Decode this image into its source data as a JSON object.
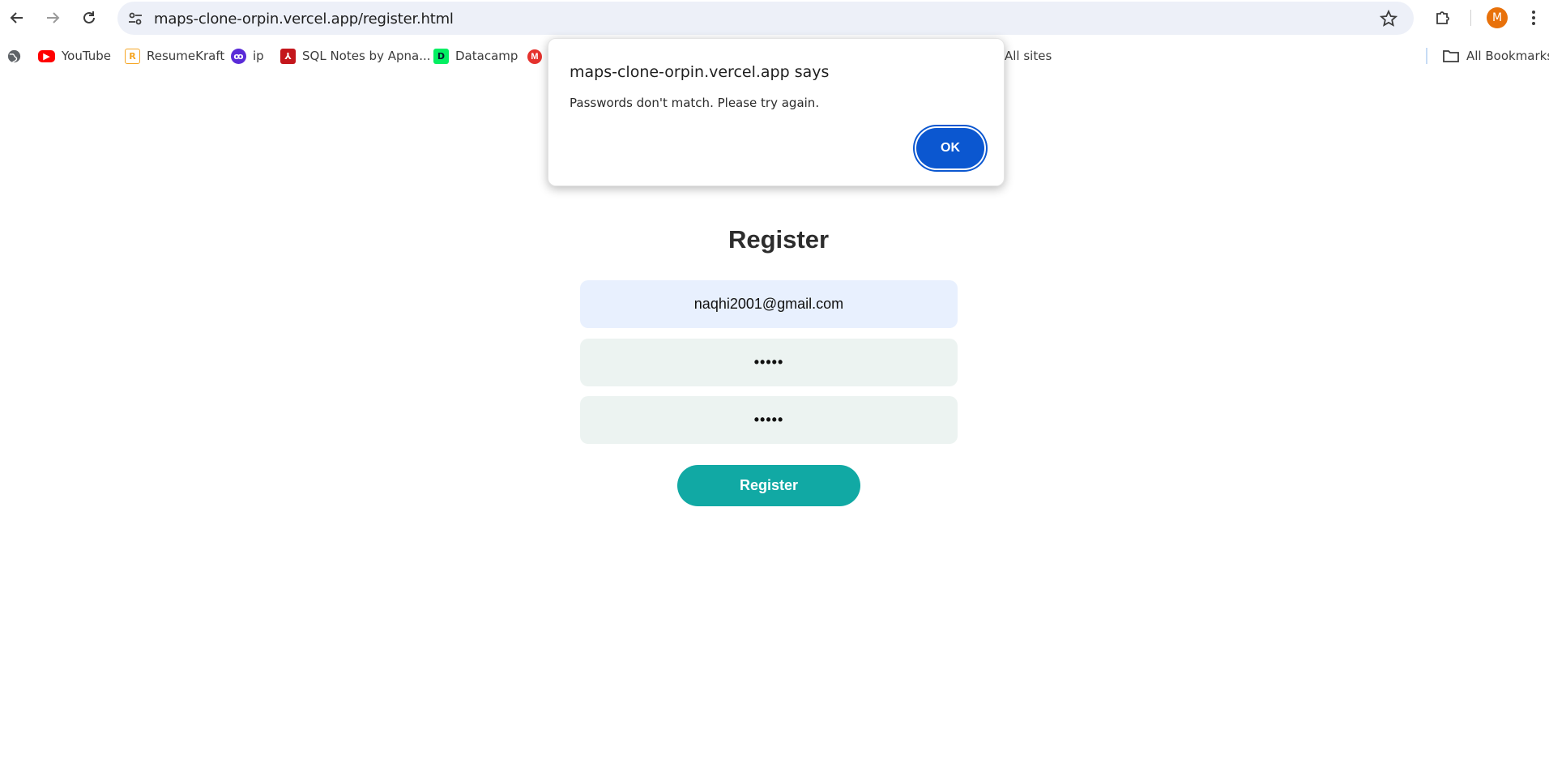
{
  "browser": {
    "url": "maps-clone-orpin.vercel.app/register.html",
    "profile_initial": "M",
    "bookmarks": [
      {
        "label": "YouTube",
        "icon": "youtube-icon"
      },
      {
        "label": "ResumeKraft",
        "icon": "resumekraft-icon"
      },
      {
        "label": "ip",
        "icon": "ip-icon"
      },
      {
        "label": "SQL Notes by Apna...",
        "icon": "pdf-icon"
      },
      {
        "label": "Datacamp",
        "icon": "datacamp-icon"
      }
    ],
    "all_sites_label": "All sites",
    "all_bookmarks_label": "All Bookmarks"
  },
  "alert": {
    "title": "maps-clone-orpin.vercel.app says",
    "message": "Passwords don't match. Please try again.",
    "ok_label": "OK"
  },
  "form": {
    "title": "Register",
    "email_value": "naqhi2001@gmail.com",
    "password_value": "•••••",
    "confirm_value": "•••••",
    "submit_label": "Register"
  },
  "colors": {
    "accent": "#11a9a4",
    "dialog_button": "#0b57d0",
    "email_bg": "#e8f0fe",
    "password_bg": "#ecf3f1"
  }
}
